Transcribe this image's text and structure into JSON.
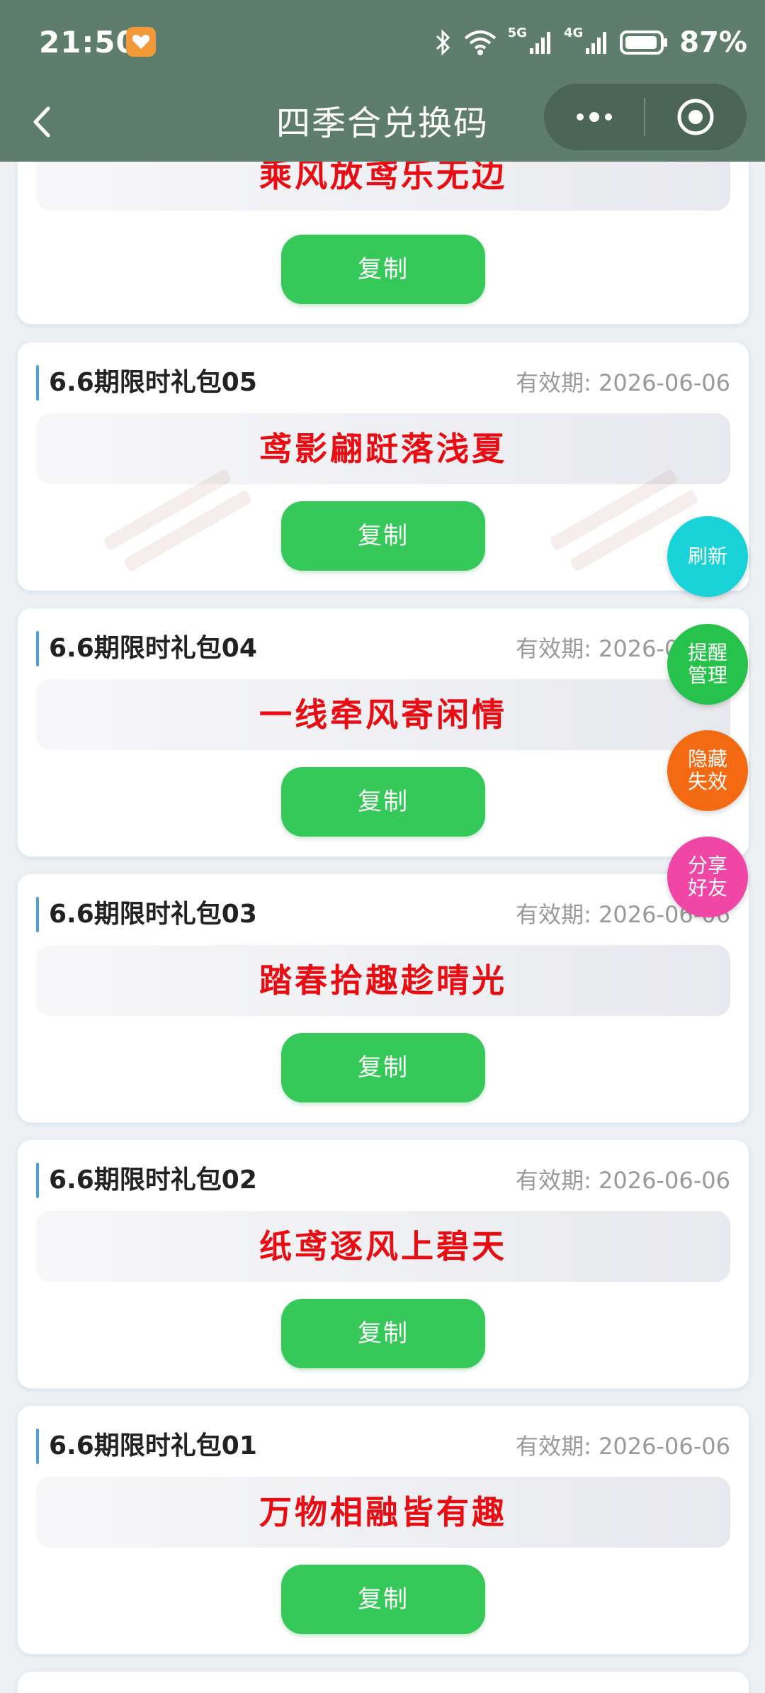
{
  "status_bar": {
    "time": "21:50",
    "network_5g": "5G",
    "network_4g": "4G",
    "battery": "87%"
  },
  "title_bar": {
    "title": "四季合兑换码"
  },
  "top_partial_card": {
    "code": "乘风放鸢乐无边",
    "copy_label": "复制"
  },
  "cards": [
    {
      "title": "6.6期限时礼包05",
      "expiry": "有效期: 2026-06-06",
      "code": "鸢影翩跹落浅夏",
      "copy_label": "复制"
    },
    {
      "title": "6.6期限时礼包04",
      "expiry": "有效期: 2026-06-06",
      "code": "一线牵风寄闲情",
      "copy_label": "复制"
    },
    {
      "title": "6.6期限时礼包03",
      "expiry": "有效期: 2026-06-06",
      "code": "踏春拾趣趁晴光",
      "copy_label": "复制"
    },
    {
      "title": "6.6期限时礼包02",
      "expiry": "有效期: 2026-06-06",
      "code": "纸鸢逐风上碧天",
      "copy_label": "复制"
    },
    {
      "title": "6.6期限时礼包01",
      "expiry": "有效期: 2026-06-06",
      "code": "万物相融皆有趣",
      "copy_label": "复制"
    }
  ],
  "floating_actions": {
    "refresh": {
      "line1": "刷新",
      "line2": "",
      "color": "#19d3d8"
    },
    "reminder": {
      "line1": "提醒",
      "line2": "管理",
      "color": "#27c24c"
    },
    "hide_expired": {
      "line1": "隐藏",
      "line2": "失效",
      "color": "#f46a12"
    },
    "share": {
      "line1": "分享",
      "line2": "好友",
      "color": "#f046a5"
    }
  },
  "colors": {
    "header_bg": "#5f7d6c",
    "code_text": "#e80d12",
    "copy_button": "#36c95a",
    "accent_bar": "#4aa3d8"
  }
}
